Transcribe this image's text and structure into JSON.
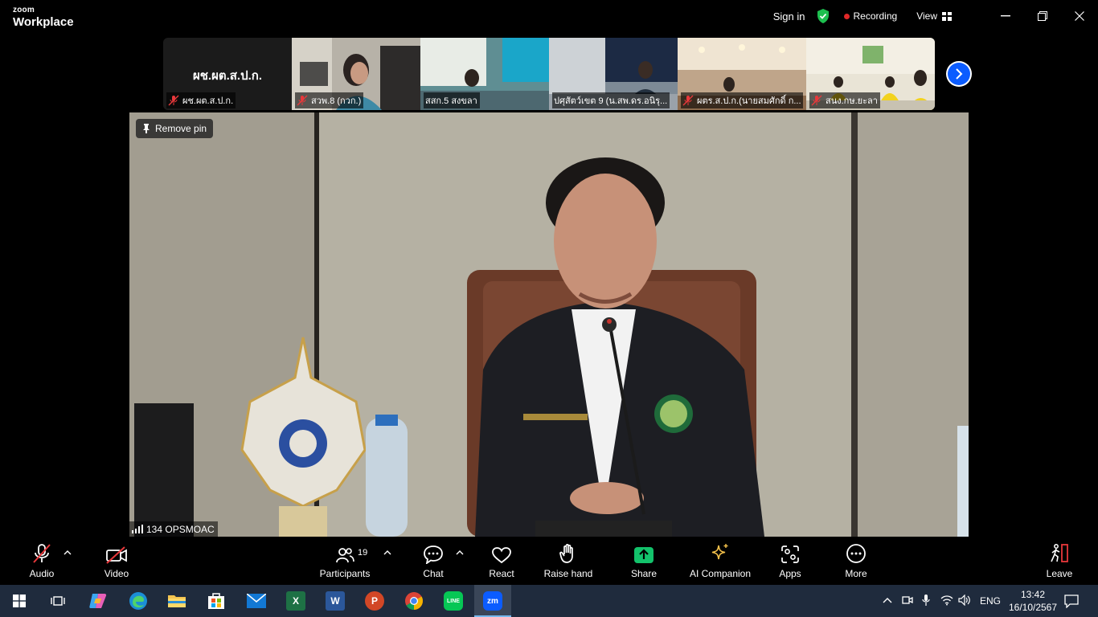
{
  "app": {
    "brand_small": "zoom",
    "brand_large": "Workplace"
  },
  "titlebar": {
    "sign_in": "Sign in",
    "recording": "Recording",
    "view": "View"
  },
  "thumbnails": [
    {
      "big_text": "ผช.ผต.ส.ป.ก.",
      "label": "ผช.ผต.ส.ป.ก."
    },
    {
      "label": "สวพ.8 (กวก.)"
    },
    {
      "label": "สสก.5 สงขลา"
    },
    {
      "label": "ปศุสัตว์เขต 9 (น.สพ.ดร.อนิรุ..."
    },
    {
      "label": "ผตร.ส.ป.ก.(นายสมศักดิ์ ก..."
    },
    {
      "label": "สนง.กษ.ยะลา"
    }
  ],
  "main_video": {
    "remove_pin": "Remove pin",
    "name_tag": "134 OPSMOAC"
  },
  "toolbar": {
    "audio": "Audio",
    "video": "Video",
    "participants": "Participants",
    "participants_count": "19",
    "chat": "Chat",
    "react": "React",
    "raise_hand": "Raise hand",
    "share": "Share",
    "ai_companion": "AI Companion",
    "apps": "Apps",
    "more": "More",
    "leave": "Leave"
  },
  "taskbar": {
    "apps": [
      {
        "name": "Start",
        "icon": "windows-logo-icon"
      },
      {
        "name": "Task View",
        "icon": "task-view-icon"
      },
      {
        "name": "Copilot",
        "icon": "copilot-icon"
      },
      {
        "name": "Edge",
        "icon": "edge-icon"
      },
      {
        "name": "File Explorer",
        "icon": "folder-icon"
      },
      {
        "name": "Microsoft Store",
        "icon": "store-icon"
      },
      {
        "name": "Mail",
        "icon": "mail-icon"
      },
      {
        "name": "Excel",
        "letter": "X"
      },
      {
        "name": "Word",
        "letter": "W"
      },
      {
        "name": "PowerPoint",
        "letter": "P"
      },
      {
        "name": "Chrome",
        "icon": "chrome-icon"
      },
      {
        "name": "LINE",
        "letter": "LINE"
      },
      {
        "name": "Zoom",
        "letter": "zm"
      }
    ],
    "language": "ENG",
    "time": "13:42",
    "date": "16/10/2567"
  },
  "colors": {
    "recording_dot": "#e02828",
    "shield_green": "#1dbf4f",
    "zoom_blue": "#0b5cff",
    "share_green": "#13c26b",
    "muted_red": "#e8383b",
    "taskbar_bg": "#1f2b3d"
  }
}
